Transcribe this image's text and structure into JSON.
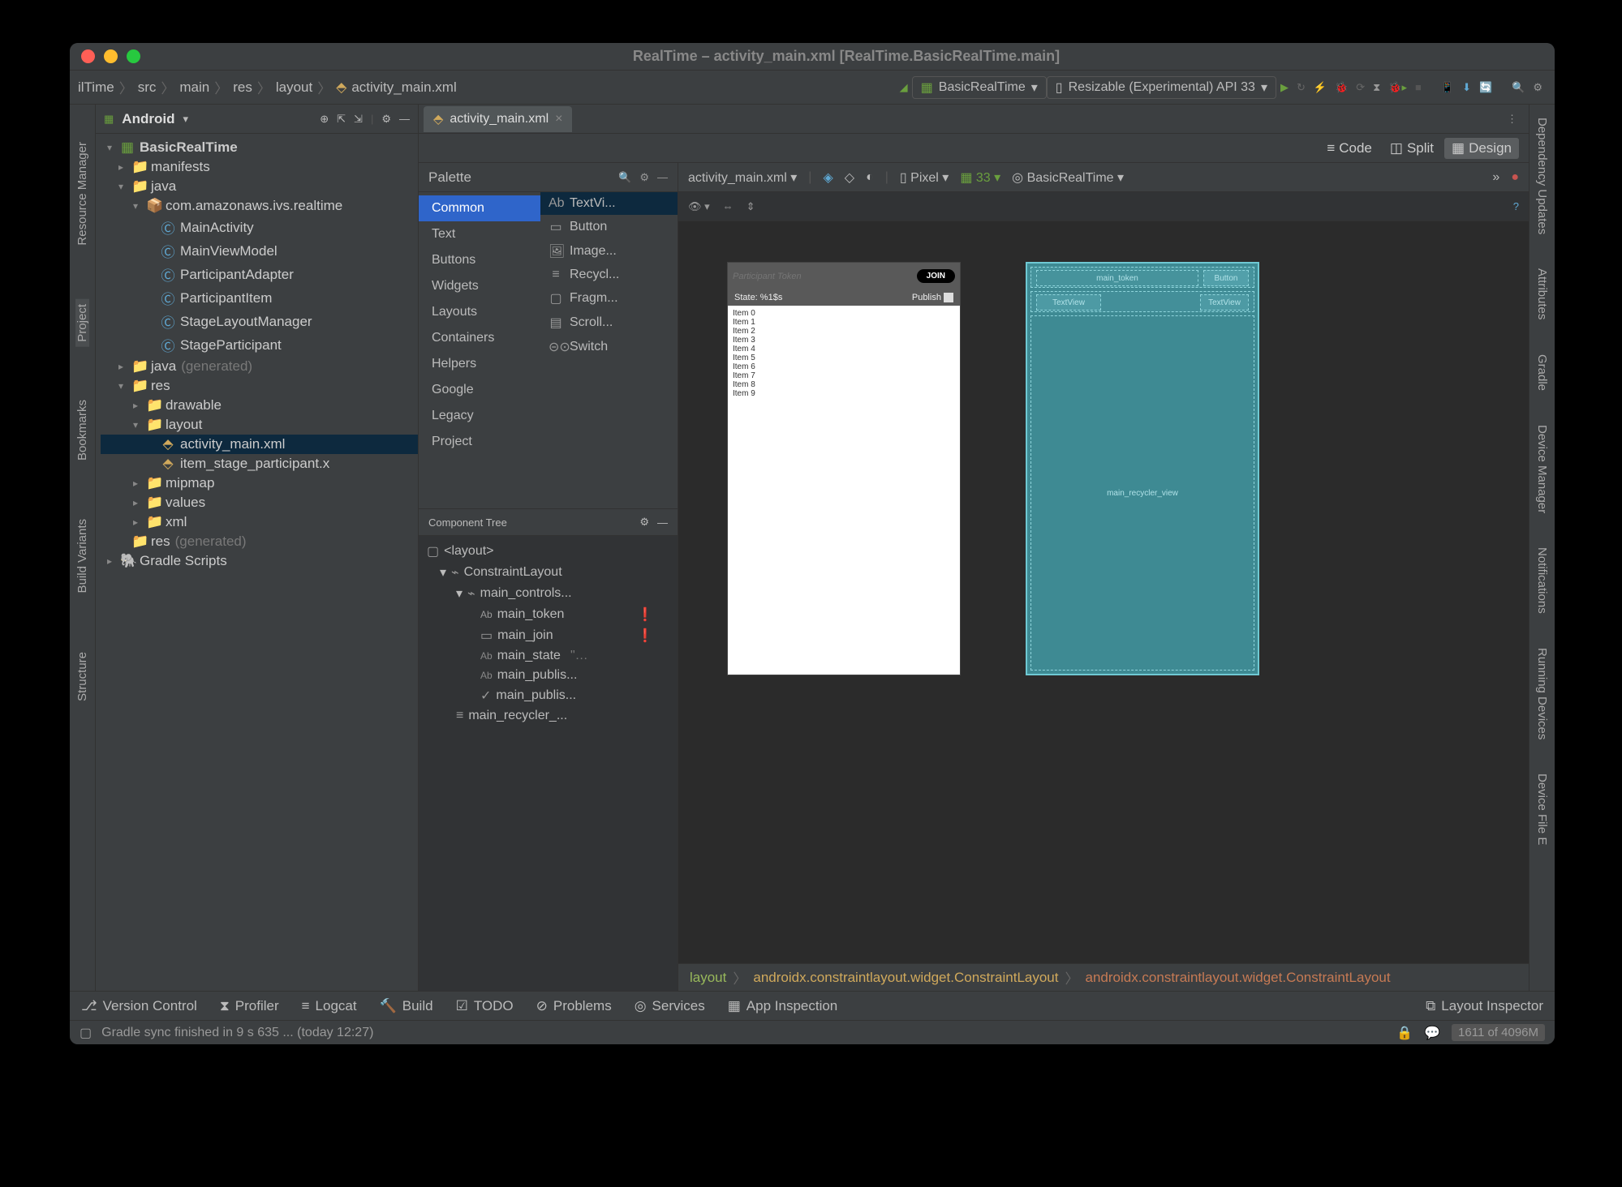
{
  "window_title": "RealTime – activity_main.xml [RealTime.BasicRealTime.main]",
  "breadcrumb": [
    "ilTime",
    "src",
    "main",
    "res",
    "layout",
    "activity_main.xml"
  ],
  "run_configs": {
    "a": "BasicRealTime",
    "b": "Resizable (Experimental) API 33"
  },
  "left_rail": {
    "resource": "Resource Manager",
    "project": "Project",
    "bookmarks": "Bookmarks",
    "variants": "Build Variants",
    "structure": "Structure"
  },
  "right_rail": {
    "deps": "Dependency Updates",
    "attrs": "Attributes",
    "gradle": "Gradle",
    "device": "Device Manager",
    "notif": "Notifications",
    "running": "Running Devices",
    "file": "Device File E"
  },
  "project": {
    "label": "Android",
    "root": "BasicRealTime",
    "manifests": "manifests",
    "java": "java",
    "pkg": "com.amazonaws.ivs.realtime",
    "classes": [
      "MainActivity",
      "MainViewModel",
      "ParticipantAdapter",
      "ParticipantItem",
      "StageLayoutManager",
      "StageParticipant"
    ],
    "java_gen": "java",
    "gen": "(generated)",
    "res": "res",
    "drawable": "drawable",
    "layout": "layout",
    "layout_files": [
      "activity_main.xml",
      "item_stage_participant.x"
    ],
    "mipmap": "mipmap",
    "values": "values",
    "xml": "xml",
    "res_gen": "res",
    "gradle": "Gradle Scripts"
  },
  "tab": {
    "name": "activity_main.xml"
  },
  "viewmodes": {
    "code": "Code",
    "split": "Split",
    "design": "Design"
  },
  "palette": {
    "title": "Palette",
    "categories": [
      "Common",
      "Text",
      "Buttons",
      "Widgets",
      "Layouts",
      "Containers",
      "Helpers",
      "Google",
      "Legacy",
      "Project"
    ],
    "items": [
      "TextVi...",
      "Button",
      "Image...",
      "Recycl...",
      "Fragm...",
      "Scroll...",
      "Switch"
    ]
  },
  "comptree": {
    "title": "Component Tree",
    "layout": "<layout>",
    "cl": "ConstraintLayout",
    "controls": "main_controls...",
    "children": [
      "main_token",
      "main_join",
      "main_state",
      "main_publis...",
      "main_publis...",
      "main_recycler_..."
    ]
  },
  "designbar": {
    "file": "activity_main.xml",
    "device": "Pixel",
    "api": "33",
    "theme": "BasicRealTime"
  },
  "preview": {
    "placeholder": "Participant Token",
    "join": "JOIN",
    "state": "State: %1$s",
    "publish": "Publish",
    "items": [
      "Item 0",
      "Item 1",
      "Item 2",
      "Item 3",
      "Item 4",
      "Item 5",
      "Item 6",
      "Item 7",
      "Item 8",
      "Item 9"
    ]
  },
  "blueprint": {
    "token": "main_token",
    "button": "Button",
    "tv1": "TextView",
    "tv2": "TextView",
    "recycler": "main_recycler_view"
  },
  "navpath": {
    "a": "layout",
    "b": "androidx.constraintlayout.widget.ConstraintLayout",
    "c": "androidx.constraintlayout.widget.ConstraintLayout"
  },
  "bottom": {
    "vc": "Version Control",
    "profiler": "Profiler",
    "logcat": "Logcat",
    "build": "Build",
    "todo": "TODO",
    "problems": "Problems",
    "services": "Services",
    "inspection": "App Inspection",
    "inspector": "Layout Inspector"
  },
  "status": {
    "msg": "Gradle sync finished in 9 s 635 ... (today 12:27)",
    "mem": "1611 of 4096M"
  }
}
